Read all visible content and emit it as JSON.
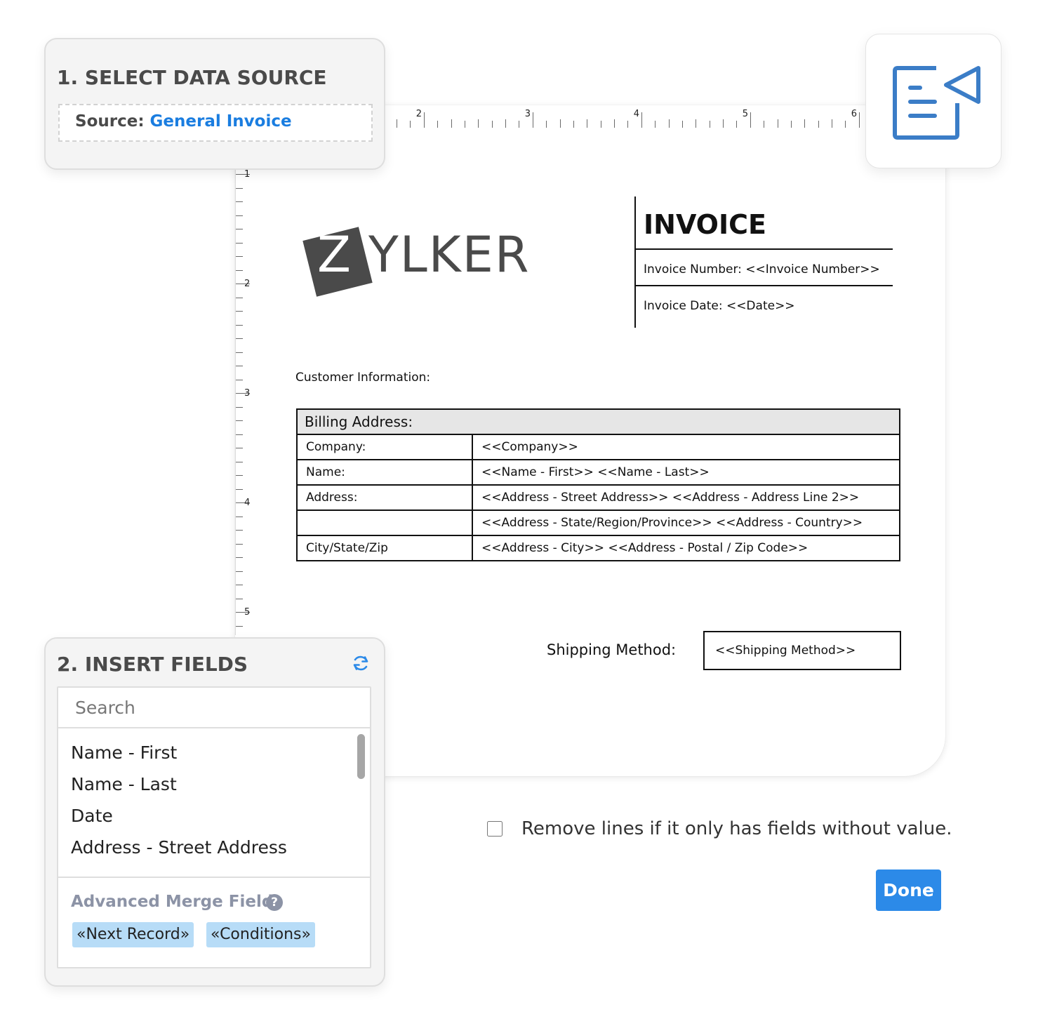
{
  "panel1": {
    "title": "1. SELECT DATA SOURCE",
    "source_label": "Source:",
    "source_value": "General Invoice"
  },
  "ruler": {
    "horizontal_numbers": [
      "2",
      "3",
      "4",
      "5",
      "6"
    ],
    "vertical_numbers": [
      "1",
      "2",
      "3",
      "4",
      "5"
    ]
  },
  "document": {
    "logo_letter": "Z",
    "logo_rest": "YLKER",
    "invoice_title": "INVOICE",
    "invoice_number": "Invoice Number: <<Invoice Number>>",
    "invoice_date": "Invoice Date: <<Date>>",
    "customer_info": "Customer Information:",
    "billing": {
      "header": "Billing Address:",
      "rows": [
        {
          "label": "Company:",
          "value": "<<Company>>"
        },
        {
          "label": "Name:",
          "value": "<<Name - First>>  <<Name - Last>>"
        },
        {
          "label": "Address:",
          "value": "<<Address - Street Address>> <<Address - Address Line 2>>"
        },
        {
          "label": "",
          "value": "<<Address - State/Region/Province>>  <<Address - Country>>"
        },
        {
          "label": "City/State/Zip",
          "value": "<<Address - City>>  <<Address - Postal / Zip Code>>"
        }
      ]
    },
    "shipping_label": "Shipping Method:",
    "shipping_value": "<<Shipping Method>>"
  },
  "panel2": {
    "title": "2. INSERT FIELDS",
    "search_placeholder": "Search",
    "fields": [
      "Name - First",
      "Name - Last",
      "Date",
      "Address - Street Address"
    ],
    "advanced_label": "Advanced Merge Fields",
    "help_glyph": "?",
    "chips": [
      "«Next Record»",
      "«Conditions»"
    ]
  },
  "options": {
    "remove_lines_label": "Remove lines if it only has fields without value.",
    "remove_lines_checked": false,
    "done_label": "Done"
  },
  "icons": {
    "top_right": "mail-merge-send-icon",
    "refresh": "refresh-icon"
  },
  "colors": {
    "accent": "#2c8ae8",
    "link": "#1a7de0",
    "chip": "#b7dcf7",
    "icon_blue": "#3b7dc7",
    "muted": "#8c93a6"
  }
}
